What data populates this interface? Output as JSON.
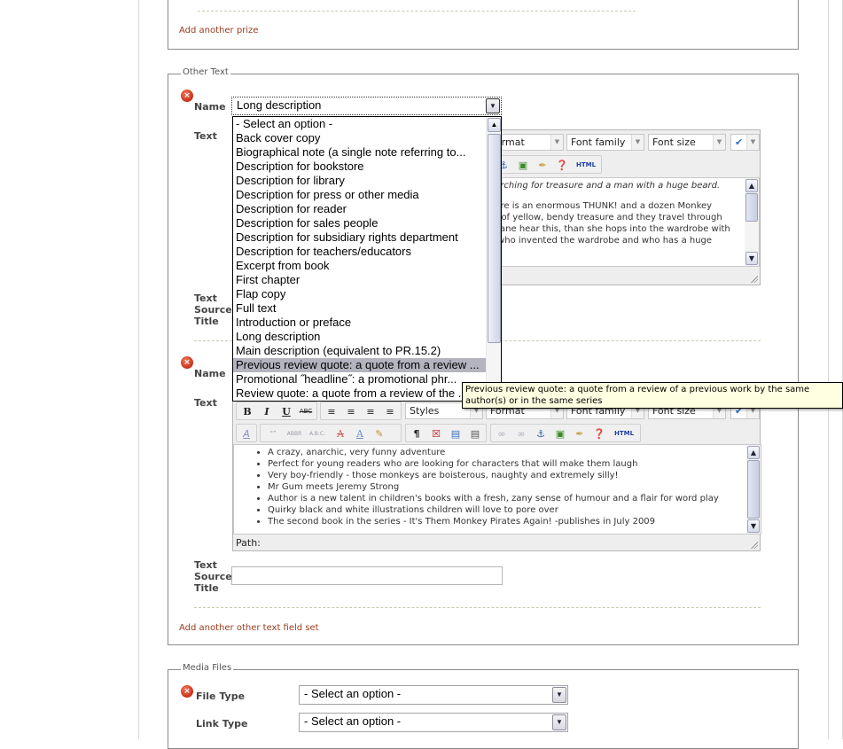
{
  "prizes_section": {
    "add_link": "Add another prize"
  },
  "other_text_section": {
    "legend": "Other Text",
    "set1": {
      "name_label": "Name",
      "name_value": "Long description",
      "text_label": "Text",
      "text_source_title_label": [
        "Text",
        "Source",
        "Title"
      ],
      "editor": {
        "format_select": "Format",
        "font_family_select": "Font family",
        "font_size_select": "Font size",
        "content_lines": [
          "earching for treasure and a man with a huge beard.",
          "",
          "here is an enormous THUNK! and a dozen Monkey",
          "th of yellow, bendy treasure and they travel through",
          "y Jane hear this, than she hops into the wardrobe with",
          "y who invented the wardrobe and who has a huge"
        ]
      }
    },
    "set2": {
      "name_label": "Name",
      "text_label": "Text",
      "text_source_title_label": [
        "Text",
        "Source",
        "Title"
      ],
      "text_source_title_value": "",
      "editor": {
        "styles_select": "Styles",
        "format_select": "Format",
        "font_family_select": "Font family",
        "font_size_select": "Font size",
        "path_label": "Path:",
        "bullets": [
          "A crazy, anarchic, very funny adventure",
          "Perfect for young readers who are looking for characters that will make them laugh",
          "Very boy-friendly - those monkeys are boisterous, naughty and extremely silly!",
          "Mr Gum meets Jeremy Strong",
          "Author is a new talent in children's books with a fresh, zany sense of humour and a flair for word play",
          "Quirky black and white illustrations children will love to pore over",
          "The second book in the series - It's Them Monkey Pirates Again! -publishes in July 2009"
        ]
      }
    },
    "add_link": "Add another other text field set"
  },
  "name_dropdown": {
    "selected_index": 17,
    "options": [
      "- Select an option -",
      "Back cover copy",
      "Biographical note (a single note referring to...",
      "Description for bookstore",
      "Description for library",
      "Description for press or other media",
      "Description for reader",
      "Description for sales people",
      "Description for subsidiary rights department",
      "Description for teachers/educators",
      "Excerpt from book",
      "First chapter",
      "Flap copy",
      "Full text",
      "Introduction or preface",
      "Long description",
      "Main description (equivalent to PR.15.2)",
      "Previous review quote: a quote from a review ...",
      "Promotional ˝headline˝: a promotional phr...",
      "Review quote: a quote from a review of the ..."
    ]
  },
  "tooltip": {
    "text": "Previous review quote: a quote from a review of a previous work by the same author(s) or in the same series"
  },
  "media_files_section": {
    "legend": "Media Files",
    "file_type_label": "File Type",
    "file_type_value": "- Select an option -",
    "link_type_label": "Link Type",
    "link_type_value": "- Select an option -"
  },
  "icons": {
    "error": "×",
    "dropdown_arrow": "⌄",
    "scroll_up": "˄",
    "scroll_down": "˅"
  },
  "colors": {
    "link": "#9a3b1c",
    "tooltip_bg": "#ffffe1",
    "selected_option_bg": "#b4b4c0"
  }
}
